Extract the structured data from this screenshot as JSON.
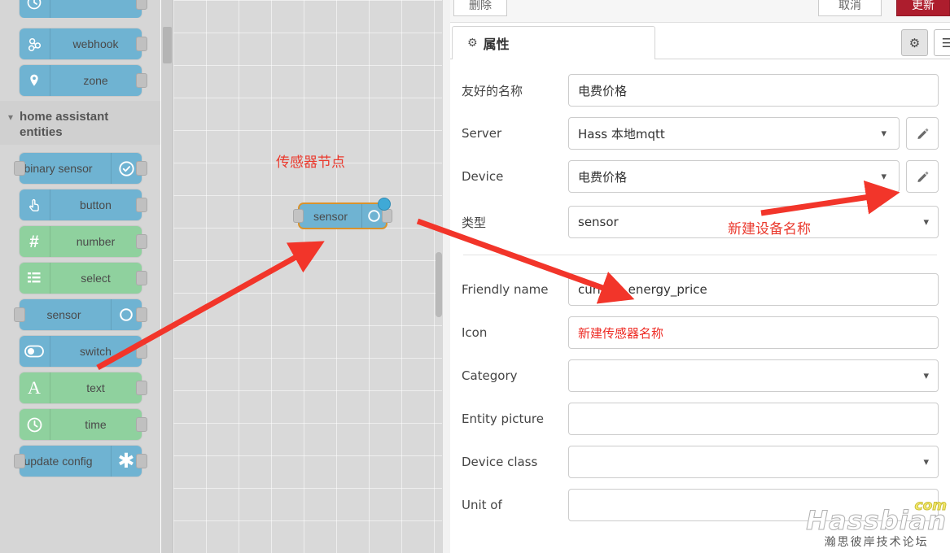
{
  "palette": {
    "groups": [
      {
        "name": "top-partial",
        "header": null,
        "nodes": [
          {
            "label": "",
            "color": "blue",
            "icon": "clock-icon",
            "icon_side": "left",
            "partial": true
          }
        ]
      },
      {
        "name": "home-assistant",
        "header": null,
        "nodes": [
          {
            "label": "webhook",
            "color": "blue",
            "icon": "webhook-icon",
            "icon_side": "left"
          },
          {
            "label": "zone",
            "color": "blue",
            "icon": "map-pin-icon",
            "icon_side": "left"
          }
        ]
      },
      {
        "name": "home-assistant-entities",
        "header": "home assistant entities",
        "nodes": [
          {
            "label": "binary sensor",
            "color": "blue",
            "icon": "check-circle-icon",
            "icon_side": "right",
            "has_input": true
          },
          {
            "label": "button",
            "color": "blue",
            "icon": "hand-pointer-icon",
            "icon_side": "left"
          },
          {
            "label": "number",
            "color": "green",
            "icon": "hash-icon",
            "icon_side": "left"
          },
          {
            "label": "select",
            "color": "green",
            "icon": "list-icon",
            "icon_side": "left"
          },
          {
            "label": "sensor",
            "color": "blue",
            "icon": "circle-icon",
            "icon_side": "right",
            "has_input": true
          },
          {
            "label": "switch",
            "color": "blue",
            "icon": "toggle-icon",
            "icon_side": "left"
          },
          {
            "label": "text",
            "color": "green",
            "icon": "letter-a-icon",
            "icon_side": "left"
          },
          {
            "label": "time",
            "color": "green",
            "icon": "clock-icon",
            "icon_side": "left"
          },
          {
            "label": "update config",
            "color": "blue",
            "icon": "asterisk-icon",
            "icon_side": "right",
            "has_input": true
          }
        ]
      }
    ]
  },
  "canvas": {
    "annotation": "传感器节点",
    "node": {
      "label": "sensor",
      "icon": "circle-icon",
      "status": "blue-dot"
    }
  },
  "editor": {
    "toolbar": {
      "delete_label": "删除",
      "cancel_label": "取消",
      "update_label": "更新"
    },
    "tab": {
      "label": "属性",
      "icon": "gear-icon"
    },
    "icon_buttons": [
      {
        "name": "gear-icon",
        "glyph": "⚙"
      },
      {
        "name": "list-icon",
        "glyph": "☰"
      }
    ],
    "fields": [
      {
        "name": "friendly-name-cn",
        "label": "友好的名称",
        "value": "电费价格",
        "type": "text",
        "pencil": false
      },
      {
        "name": "server",
        "label": "Server",
        "value": "Hass 本地mqtt",
        "type": "select",
        "pencil": true
      },
      {
        "name": "device",
        "label": "Device",
        "value": "电费价格",
        "type": "select",
        "pencil": true
      },
      {
        "name": "type-cn",
        "label": "类型",
        "value": "sensor",
        "type": "select",
        "pencil": false
      }
    ],
    "fields2": [
      {
        "name": "friendly-name",
        "label": "Friendly name",
        "value": "current_energy_price",
        "type": "text",
        "red": false
      },
      {
        "name": "icon",
        "label": "Icon",
        "value": "新建传感器名称",
        "type": "text",
        "red": true
      },
      {
        "name": "category",
        "label": "Category",
        "value": "",
        "type": "select"
      },
      {
        "name": "entity-picture",
        "label": "Entity picture",
        "value": "",
        "type": "text"
      },
      {
        "name": "device-class",
        "label": "Device class",
        "value": "",
        "type": "select"
      },
      {
        "name": "unit-of",
        "label": "Unit of",
        "value": "",
        "type": "text"
      }
    ],
    "annotations": {
      "new_device_name": "新建设备名称"
    }
  },
  "watermark": {
    "main": "Hassbian",
    "suffix": "com",
    "sub": "瀚思彼岸技术论坛"
  },
  "colors": {
    "node_blue": "#6fb3d2",
    "node_green": "#8fd19e",
    "node_selected_border": "#d9922c",
    "annotation_red": "#ea3a2e",
    "update_button": "#ad1d2d"
  }
}
